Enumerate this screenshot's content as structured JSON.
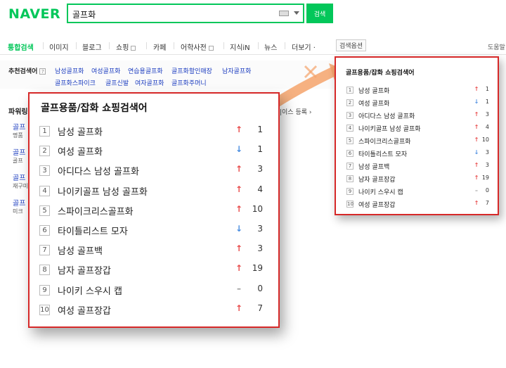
{
  "header": {
    "logo": "NAVER",
    "search_value": "골프화",
    "search_button": "검색"
  },
  "nav": {
    "items": [
      "통합검색",
      "이미지",
      "블로그",
      "쇼핑",
      "카페",
      "어학사전",
      "지식iN",
      "뉴스",
      "더보기"
    ],
    "more_caret": "·",
    "options": "검색옵션",
    "help": "도움말"
  },
  "related": {
    "label": "추천검색어",
    "help_mark": "?",
    "row1": [
      "남성골프화",
      "여성골프화",
      "연습용골프화",
      "골프화할인매장",
      "남자골프화"
    ],
    "row2": [
      "골프화스파이크",
      "골프신발",
      "여자골프화",
      "골프화주머니"
    ]
  },
  "background": {
    "power_label": "파워링",
    "links": [
      "골프",
      "골프",
      "골프",
      "골프"
    ],
    "subs": [
      "명품",
      "골프",
      "재구미",
      "미크"
    ],
    "register": "|이스 등록 ›"
  },
  "ranking": {
    "title": "골프용품/잡화 쇼핑검색어",
    "items": [
      {
        "rank": "1",
        "name": "남성 골프화",
        "trend": "up",
        "arrow": "↑",
        "change": "1"
      },
      {
        "rank": "2",
        "name": "여성 골프화",
        "trend": "down",
        "arrow": "↓",
        "change": "1"
      },
      {
        "rank": "3",
        "name": "아디다스 남성 골프화",
        "trend": "up",
        "arrow": "↑",
        "change": "3"
      },
      {
        "rank": "4",
        "name": "나이키골프 남성 골프화",
        "trend": "up",
        "arrow": "↑",
        "change": "4"
      },
      {
        "rank": "5",
        "name": "스파이크리스골프화",
        "trend": "up",
        "arrow": "↑",
        "change": "10"
      },
      {
        "rank": "6",
        "name": "타이틀리스트 모자",
        "trend": "down",
        "arrow": "↓",
        "change": "3"
      },
      {
        "rank": "7",
        "name": "남성 골프백",
        "trend": "up",
        "arrow": "↑",
        "change": "3"
      },
      {
        "rank": "8",
        "name": "남자 골프장갑",
        "trend": "up",
        "arrow": "↑",
        "change": "19"
      },
      {
        "rank": "9",
        "name": "나이키 스우시 캡",
        "trend": "same",
        "arrow": "–",
        "change": "0"
      },
      {
        "rank": "10",
        "name": "여성 골프장갑",
        "trend": "up",
        "arrow": "↑",
        "change": "7"
      }
    ]
  },
  "colors": {
    "brand": "#03c75a",
    "highlight_border": "#d62828",
    "up": "#e84a4a",
    "down": "#4a8de0",
    "arrow": "#f5a36b"
  }
}
